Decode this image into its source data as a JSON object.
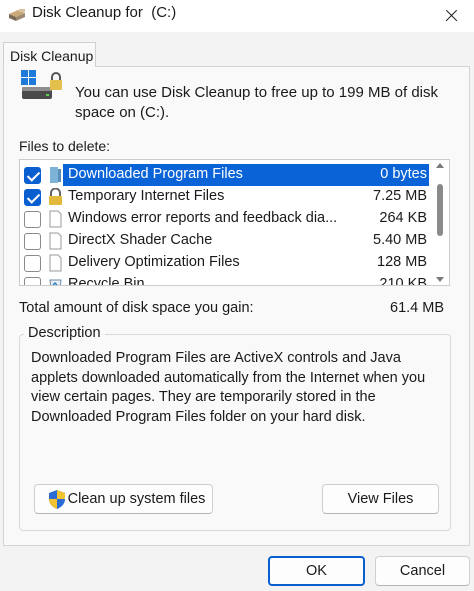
{
  "window": {
    "title": "Disk Cleanup for  (C:)",
    "title_icon": "disk-cleanup-icon",
    "close_icon": "close-icon"
  },
  "tab": {
    "label": "Disk Cleanup"
  },
  "intro": {
    "text": "You can use Disk Cleanup to free up to 199 MB of disk space on  (C:).",
    "icon": "drive-lock-icon"
  },
  "files": {
    "label": "Files to delete:",
    "items": [
      {
        "name": "Downloaded Program Files",
        "size": "0 bytes",
        "checked": true,
        "selected": true,
        "icon": "folder-icon"
      },
      {
        "name": "Temporary Internet Files",
        "size": "7.25 MB",
        "checked": true,
        "selected": false,
        "icon": "lock-icon"
      },
      {
        "name": "Windows error reports and feedback dia...",
        "size": "264 KB",
        "checked": false,
        "selected": false,
        "icon": "document-icon"
      },
      {
        "name": "DirectX Shader Cache",
        "size": "5.40 MB",
        "checked": false,
        "selected": false,
        "icon": "document-icon"
      },
      {
        "name": "Delivery Optimization Files",
        "size": "128 MB",
        "checked": false,
        "selected": false,
        "icon": "document-icon"
      },
      {
        "name": "Recycle Bin",
        "size": "210 KB",
        "checked": false,
        "selected": false,
        "icon": "recycle-bin-icon"
      }
    ]
  },
  "total": {
    "label": "Total amount of disk space you gain:",
    "value": "61.4 MB"
  },
  "description": {
    "legend": "Description",
    "text": "Downloaded Program Files are ActiveX controls and Java applets downloaded automatically from the Internet when you view certain pages. They are temporarily stored in the Downloaded Program Files folder on your hard disk."
  },
  "buttons": {
    "cleanup_system": "Clean up system files",
    "view_files": "View Files",
    "ok": "OK",
    "cancel": "Cancel"
  },
  "colors": {
    "selection": "#0a64d8",
    "checkbox": "#0a5fd0",
    "window_bg": "#f3f3f3"
  }
}
